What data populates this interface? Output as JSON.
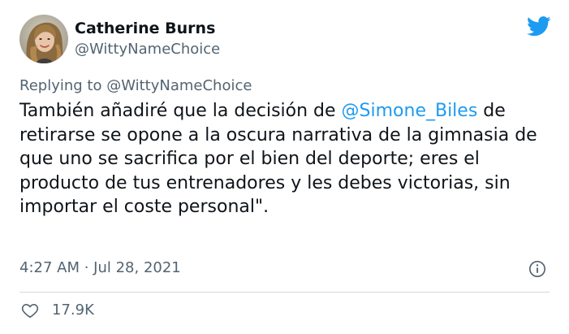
{
  "tweet": {
    "author": {
      "display_name": "Catherine Burns",
      "handle": "@WittyNameChoice"
    },
    "reply_to": {
      "prefix": "Replying to ",
      "handle": "@WittyNameChoice"
    },
    "text": {
      "part1": "También añadiré que la decisión de ",
      "mention": "@Simone_Biles",
      "part2": " de retirarse se opone a la oscura narrativa de la gimnasia de que uno se sacrifica por el bien del deporte; eres el producto de tus entrenadores y les debes victorias, sin importar el coste personal\"."
    },
    "timestamp": "4:27 AM · Jul 28, 2021",
    "likes": "17.9K"
  },
  "icons": {
    "brand": "twitter-bird-icon",
    "info": "info-icon",
    "like": "heart-icon"
  },
  "colors": {
    "accent": "#1d9bf0",
    "text": "#0f1419",
    "secondary": "#536471",
    "divider": "#cfd9de"
  }
}
